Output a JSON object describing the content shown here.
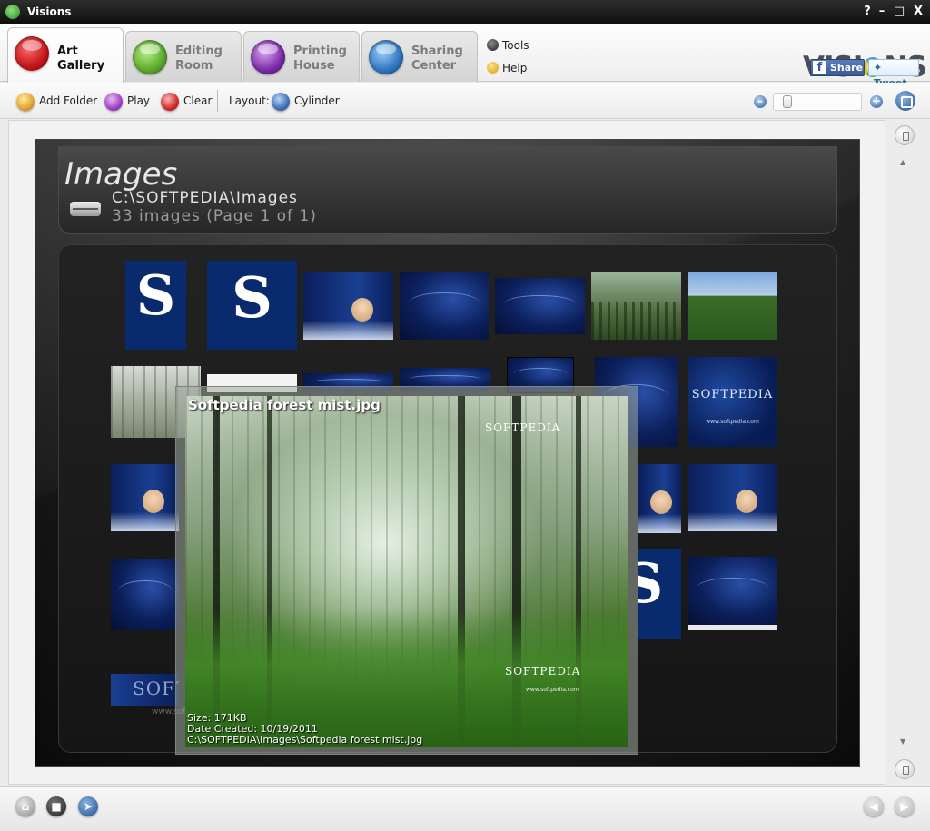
{
  "window": {
    "title": "Visions",
    "controls": {
      "help": "?",
      "minimize": "–",
      "maximize": "□",
      "close": "X"
    }
  },
  "tabs": [
    {
      "label": "Art\nGallery",
      "icon": "art-gallery-icon",
      "color": "#c0151b",
      "active": true
    },
    {
      "label": "Editing\nRoom",
      "icon": "brush-icon",
      "color": "#5ba82a",
      "active": false
    },
    {
      "label": "Printing\nHouse",
      "icon": "document-icon",
      "color": "#7a2aa8",
      "active": false
    },
    {
      "label": "Sharing\nCenter",
      "icon": "sharing-icon",
      "color": "#2f74c0",
      "active": false
    }
  ],
  "menu": {
    "tools": "Tools",
    "help": "Help"
  },
  "brand": {
    "logo_left": "VISI",
    "logo_right": "NS",
    "share_label": "Share",
    "tweet_label": "Tweet",
    "facebook_color": "#3b5998"
  },
  "toolbar": {
    "add_folder": "Add Folder",
    "play": "Play",
    "clear": "Clear",
    "layout_label": "Layout:",
    "layout_value": "Cylinder",
    "zoom_level": 0.05
  },
  "gallery": {
    "heading": "Images",
    "path": "C:\\SOFTPEDIA\\Images",
    "count": "33 images (Page 1 of 1)"
  },
  "preview": {
    "title": "Softpedia forest mist.jpg",
    "watermark": "SOFTPEDIA",
    "watermark_url": "www.softpedia.com",
    "size": "Size: 171KB",
    "date": "Date Created: 10/19/2011",
    "path": "C:\\SOFTPEDIA\\Images\\Softpedia forest mist.jpg"
  },
  "thumb_labels": {
    "s_letter": "S",
    "softpedia": "SOFTPEDIA",
    "softpedia_url": "www.softpedia.com",
    "softpedia_url_short": "www.softpe"
  }
}
